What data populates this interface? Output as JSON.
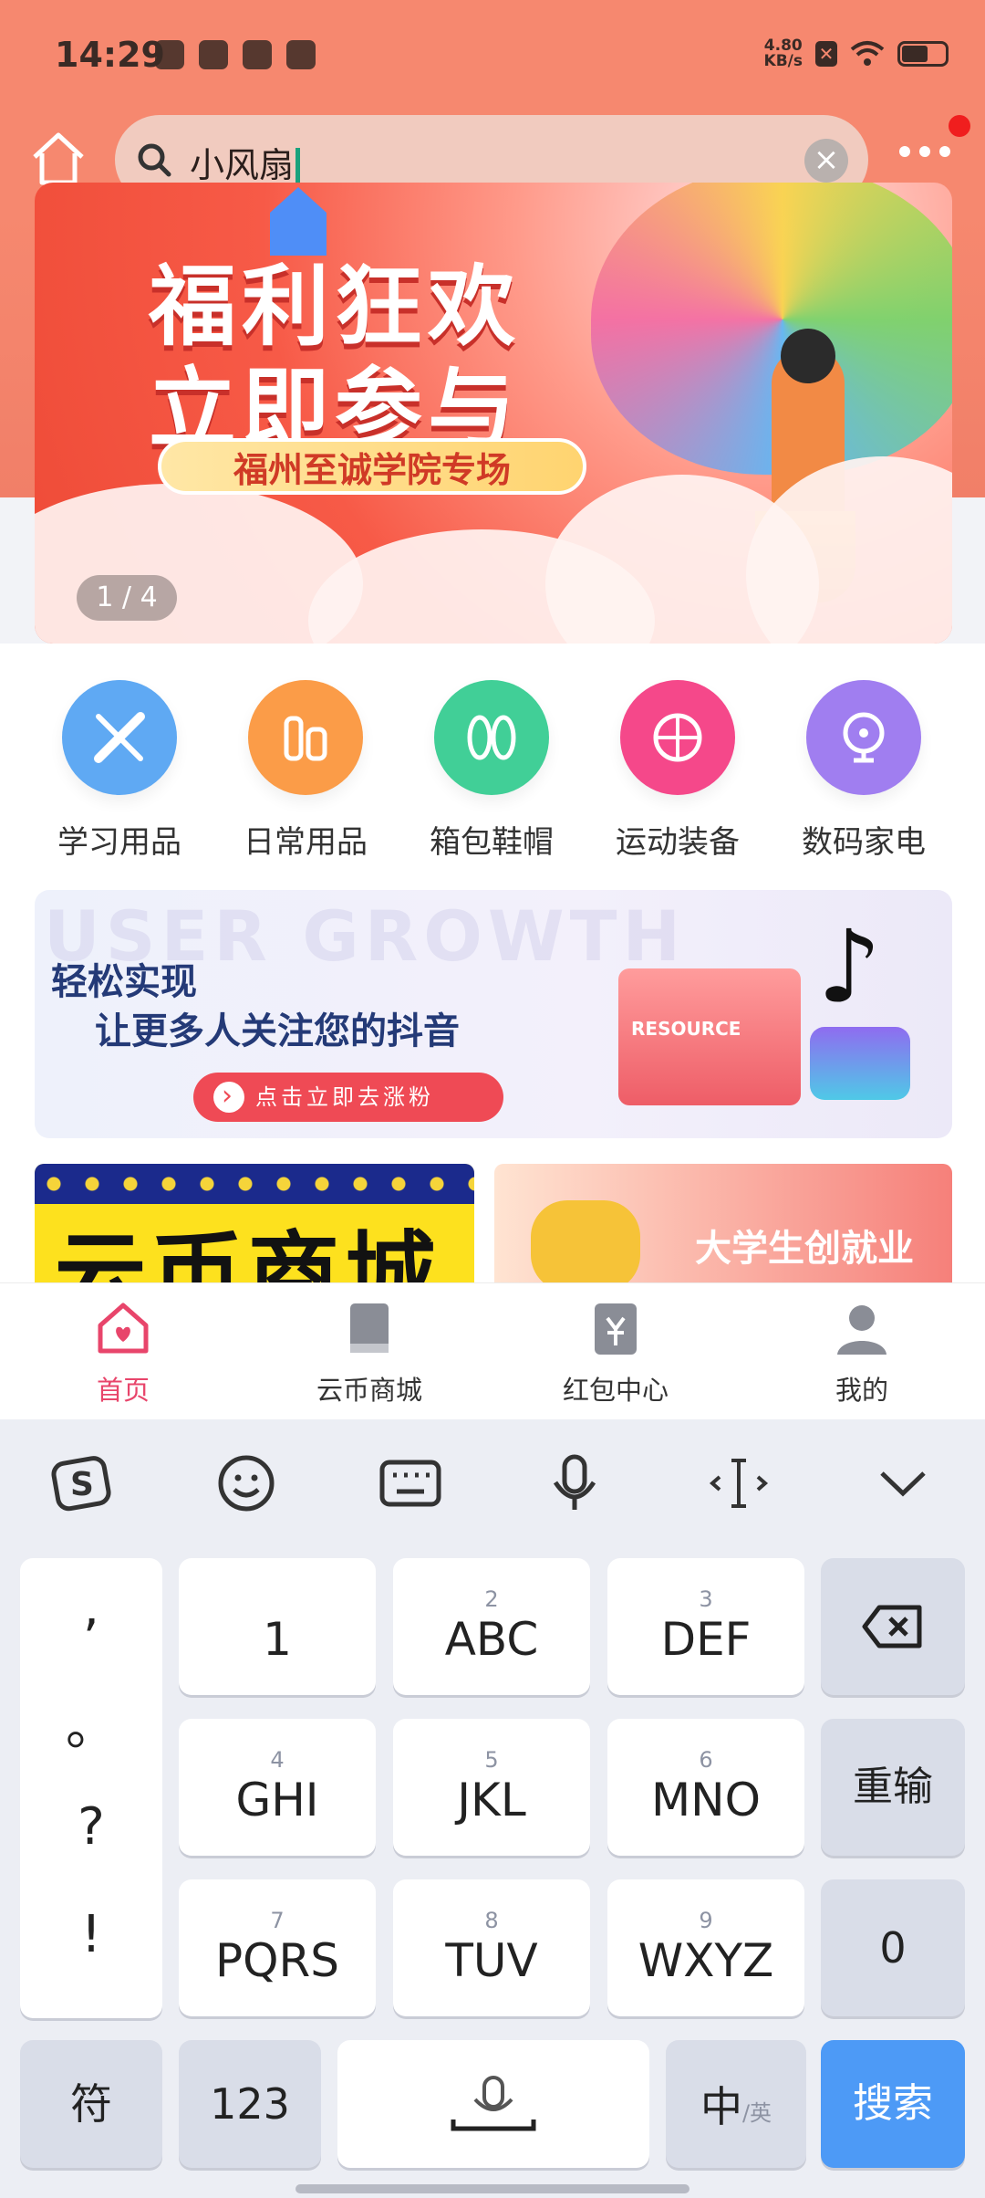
{
  "status_bar": {
    "time": "14:29",
    "net_speed_value": "4.80",
    "net_speed_unit": "KB/s"
  },
  "search": {
    "query": "小风扇"
  },
  "banner": {
    "title_line1": "福利狂欢",
    "title_line2": "立即参与",
    "ribbon": "福州至诚学院专场",
    "page_indicator": "1 / 4"
  },
  "categories": [
    {
      "label": "学习用品",
      "icon": "ruler-pencil-icon",
      "color": "#5fa9f3"
    },
    {
      "label": "日常用品",
      "icon": "bottles-icon",
      "color": "#fb9c48"
    },
    {
      "label": "箱包鞋帽",
      "icon": "shoes-icon",
      "color": "#41cf97"
    },
    {
      "label": "运动装备",
      "icon": "basketball-icon",
      "color": "#f5488a"
    },
    {
      "label": "数码家电",
      "icon": "fan-icon",
      "color": "#a07ef0"
    }
  ],
  "ad": {
    "watermark": "USER GROWTH",
    "line1": "轻松实现",
    "line2": "让更多人关注您的抖音",
    "button": "点击立即去涨粉",
    "folder_label": "RESOURCE"
  },
  "cards": {
    "yellow_text": "云币商城",
    "pink_text": "大学生创就业"
  },
  "tabbar": [
    {
      "label": "首页",
      "icon": "home-heart-icon",
      "active": true
    },
    {
      "label": "云币商城",
      "icon": "book-icon",
      "active": false
    },
    {
      "label": "红包中心",
      "icon": "red-packet-icon",
      "active": false
    },
    {
      "label": "我的",
      "icon": "person-icon",
      "active": false
    }
  ],
  "keyboard": {
    "punctuation": [
      ",",
      "。",
      "?",
      "!"
    ],
    "keys": {
      "k1": {
        "hint": "",
        "main": "1"
      },
      "k2": {
        "hint": "2",
        "main": "ABC"
      },
      "k3": {
        "hint": "3",
        "main": "DEF"
      },
      "k4": {
        "hint": "4",
        "main": "GHI"
      },
      "k5": {
        "hint": "5",
        "main": "JKL"
      },
      "k6": {
        "hint": "6",
        "main": "MNO"
      },
      "k7": {
        "hint": "7",
        "main": "PQRS"
      },
      "k8": {
        "hint": "8",
        "main": "TUV"
      },
      "k9": {
        "hint": "9",
        "main": "WXYZ"
      },
      "k0": {
        "main": "0"
      }
    },
    "reinput": "重输",
    "symbols": "符",
    "numbers": "123",
    "lang_main": "中",
    "lang_alt": "/英",
    "search": "搜索"
  },
  "colors": {
    "header": "#f6886f",
    "accent_pink": "#e8456b",
    "key_blue": "#4d9af6"
  }
}
